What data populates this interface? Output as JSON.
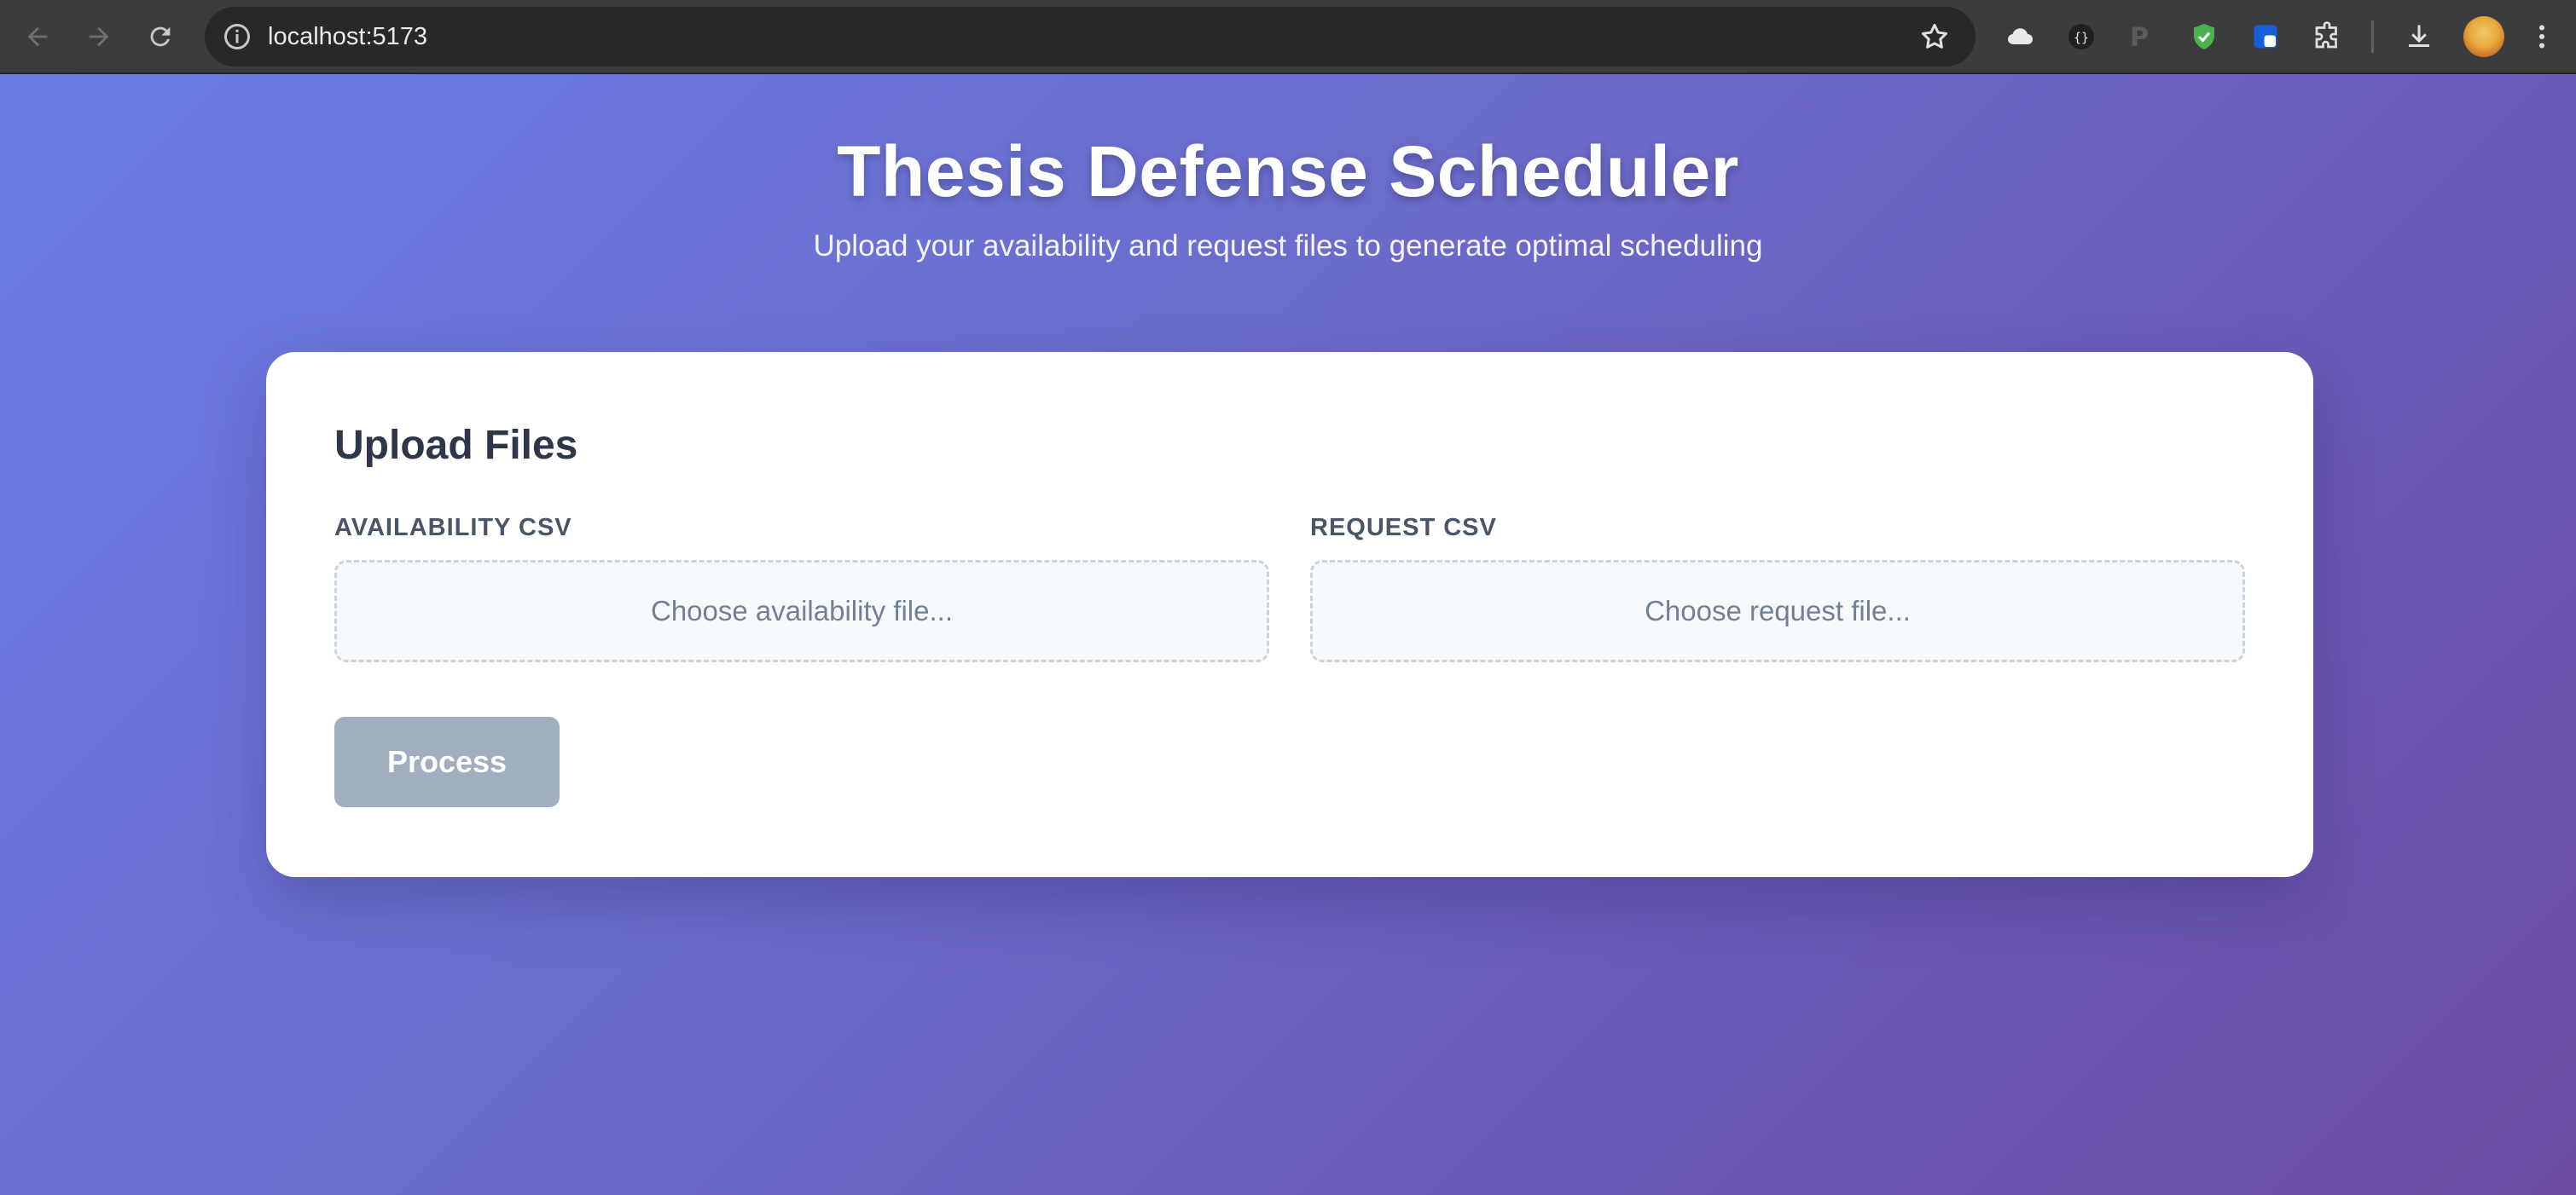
{
  "browser": {
    "url": "localhost:5173",
    "icons": [
      "back-arrow-icon",
      "forward-arrow-icon",
      "reload-icon",
      "site-info-icon",
      "bookmark-star-icon",
      "cloud-extension-icon",
      "json-extension-icon",
      "p-extension-icon",
      "shield-extension-icon",
      "bitwarden-extension-icon",
      "extensions-puzzle-icon",
      "download-icon",
      "profile-avatar",
      "menu-kebab-icon"
    ]
  },
  "header": {
    "title": "Thesis Defense Scheduler",
    "subtitle": "Upload your availability and request files to generate optimal scheduling"
  },
  "upload": {
    "heading": "Upload Files",
    "availability": {
      "label": "AVAILABILITY CSV",
      "placeholder": "Choose availability file..."
    },
    "request": {
      "label": "REQUEST CSV",
      "placeholder": "Choose request file..."
    },
    "process_label": "Process"
  },
  "colors": {
    "gradient_start": "#6a7de6",
    "gradient_end": "#6c4ea6",
    "card_bg": "#ffffff",
    "button_disabled": "#a0aec0"
  }
}
